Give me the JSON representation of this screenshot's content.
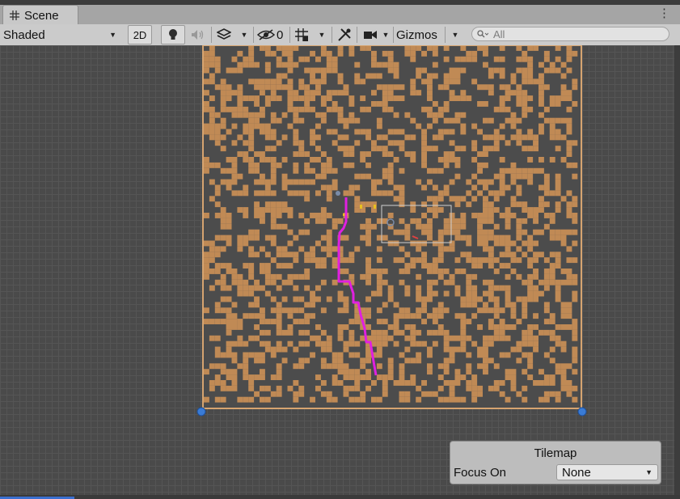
{
  "scene_tab": {
    "label": "Scene",
    "icon": "grid-hash-icon"
  },
  "toolbar": {
    "draw_mode": "Shaded",
    "btn_2d": "2D",
    "hidden_count": "0",
    "gizmos_label": "Gizmos",
    "search_placeholder": "All"
  },
  "tilemap_overlay": {
    "title": "Tilemap",
    "focus_label": "Focus On",
    "focus_value": "None"
  },
  "colors": {
    "tile": "#c08a55",
    "tile_dark": "#4c4c4c",
    "path": "#e020e0",
    "handle": "#3a7bd5",
    "border": "#d6a470"
  }
}
